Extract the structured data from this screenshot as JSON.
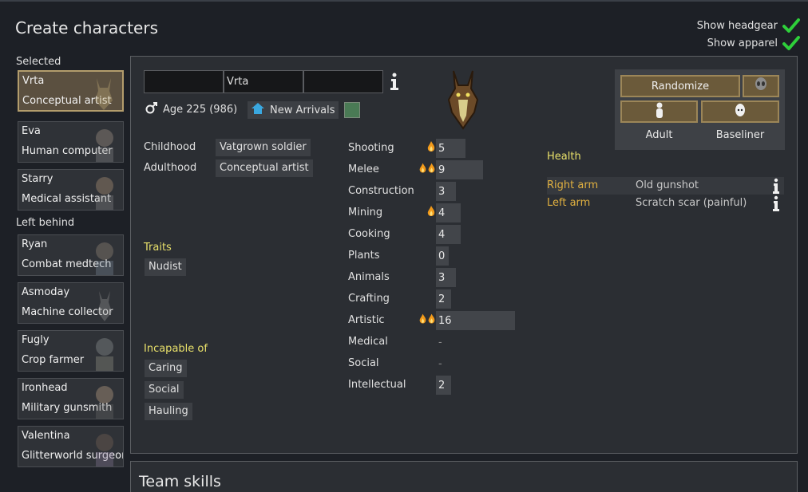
{
  "title": "Create characters",
  "toggles": [
    {
      "label": "Show headgear",
      "checked": true
    },
    {
      "label": "Show apparel",
      "checked": true
    }
  ],
  "sidebar": {
    "selected_label": "Selected",
    "left_behind_label": "Left behind",
    "selected": [
      {
        "name": "Vrta",
        "role": "Conceptual artist",
        "active": true
      },
      {
        "name": "Eva",
        "role": "Human computer"
      },
      {
        "name": "Starry",
        "role": "Medical assistant"
      }
    ],
    "left_behind": [
      {
        "name": "Ryan",
        "role": "Combat medtech"
      },
      {
        "name": "Asmoday",
        "role": "Machine collector"
      },
      {
        "name": "Fugly",
        "role": "Crop farmer"
      },
      {
        "name": "Ironhead",
        "role": "Military gunsmith"
      },
      {
        "name": "Valentina",
        "role": "Glitterworld surgeon"
      }
    ]
  },
  "pawn": {
    "first_name": "",
    "nick_name": "Vrta",
    "last_name": "",
    "age": "Age 225 (986)",
    "faction": "New Arrivals",
    "favorite_color": "#4a7a55",
    "backstory": {
      "childhood_label": "Childhood",
      "childhood": "Vatgrown soldier",
      "adulthood_label": "Adulthood",
      "adulthood": "Conceptual artist"
    },
    "traits_label": "Traits",
    "traits": [
      "Nudist"
    ],
    "incapable_label": "Incapable of",
    "incapable": [
      "Caring",
      "Social",
      "Hauling"
    ]
  },
  "skills": [
    {
      "name": "Shooting",
      "value": "5",
      "level": 5,
      "passion": 1
    },
    {
      "name": "Melee",
      "value": "9",
      "level": 9,
      "passion": 2
    },
    {
      "name": "Construction",
      "value": "3",
      "level": 3,
      "passion": 0
    },
    {
      "name": "Mining",
      "value": "4",
      "level": 4,
      "passion": 1
    },
    {
      "name": "Cooking",
      "value": "4",
      "level": 4,
      "passion": 0
    },
    {
      "name": "Plants",
      "value": "0",
      "level": 0,
      "passion": 0
    },
    {
      "name": "Animals",
      "value": "3",
      "level": 3,
      "passion": 0
    },
    {
      "name": "Crafting",
      "value": "2",
      "level": 2,
      "passion": 0
    },
    {
      "name": "Artistic",
      "value": "16",
      "level": 16,
      "passion": 2
    },
    {
      "name": "Medical",
      "value": "-",
      "level": 0,
      "passion": 0,
      "disabled": true
    },
    {
      "name": "Social",
      "value": "-",
      "level": 0,
      "passion": 0,
      "disabled": true
    },
    {
      "name": "Intellectual",
      "value": "2",
      "level": 2,
      "passion": 0
    }
  ],
  "randomize": {
    "randomize_label": "Randomize",
    "adult_label": "Adult",
    "baseliner_label": "Baseliner"
  },
  "health": {
    "title": "Health",
    "rows": [
      {
        "part": "Right arm",
        "condition": "Old gunshot"
      },
      {
        "part": "Left arm",
        "condition": "Scratch scar (painful)"
      }
    ]
  },
  "team": {
    "title": "Team skills"
  }
}
